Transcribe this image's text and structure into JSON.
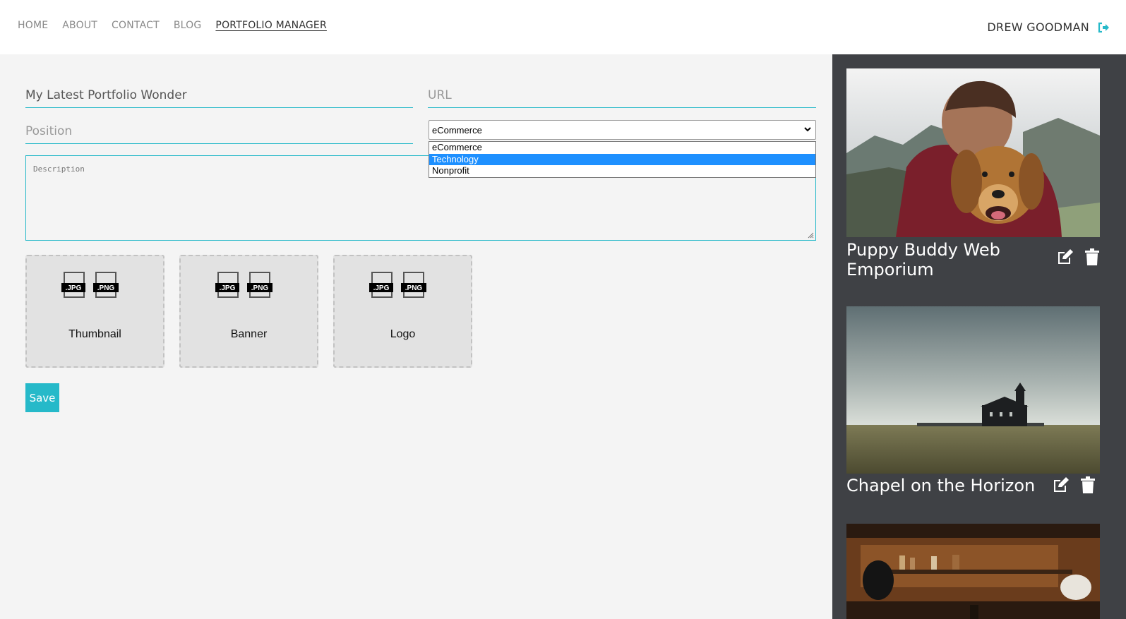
{
  "nav": {
    "items": [
      {
        "label": "HOME"
      },
      {
        "label": "ABOUT"
      },
      {
        "label": "CONTACT"
      },
      {
        "label": "BLOG"
      },
      {
        "label": "PORTFOLIO MANAGER",
        "active": true
      }
    ]
  },
  "user": {
    "name": "DREW GOODMAN",
    "logout_icon": "sign-out-icon"
  },
  "form": {
    "name_value": "My Latest Portfolio Wonder",
    "url_placeholder": "URL",
    "position_placeholder": "Position",
    "category": {
      "selected": "eCommerce",
      "options": [
        "eCommerce",
        "Technology",
        "Nonprofit"
      ],
      "highlighted": "Technology"
    },
    "description_placeholder": "Description",
    "dropzones": [
      {
        "label": "Thumbnail",
        "file_types": [
          ".JPG",
          ".PNG"
        ]
      },
      {
        "label": "Banner",
        "file_types": [
          ".JPG",
          ".PNG"
        ]
      },
      {
        "label": "Logo",
        "file_types": [
          ".JPG",
          ".PNG"
        ]
      }
    ],
    "save_label": "Save"
  },
  "portfolio_items": [
    {
      "title": "Puppy Buddy Web Emporium",
      "image": "man hugging dog outdoors"
    },
    {
      "title": "Chapel on the Horizon",
      "image": "black church in field under clouds"
    },
    {
      "title": "",
      "image": "dim bar interior"
    }
  ],
  "colors": {
    "accent": "#26b9c9",
    "sidebar_bg": "#3f4145",
    "page_bg": "#f4f4f4",
    "highlight": "#1e90ff"
  }
}
